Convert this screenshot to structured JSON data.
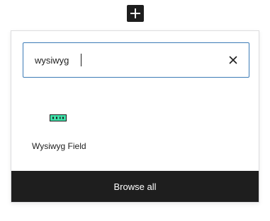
{
  "toolbar": {
    "add_block_icon": "plus-icon"
  },
  "inserter": {
    "search": {
      "value": "wysiwyg",
      "clear_icon": "close-icon"
    },
    "results": [
      {
        "label": "Wysiwyg Field",
        "icon": "wysiwyg-block-icon",
        "icon_color": "#3ee0a8"
      }
    ],
    "browse_all_label": "Browse all"
  },
  "colors": {
    "accent": "#3c7bb6",
    "dark": "#1e1e1e"
  }
}
